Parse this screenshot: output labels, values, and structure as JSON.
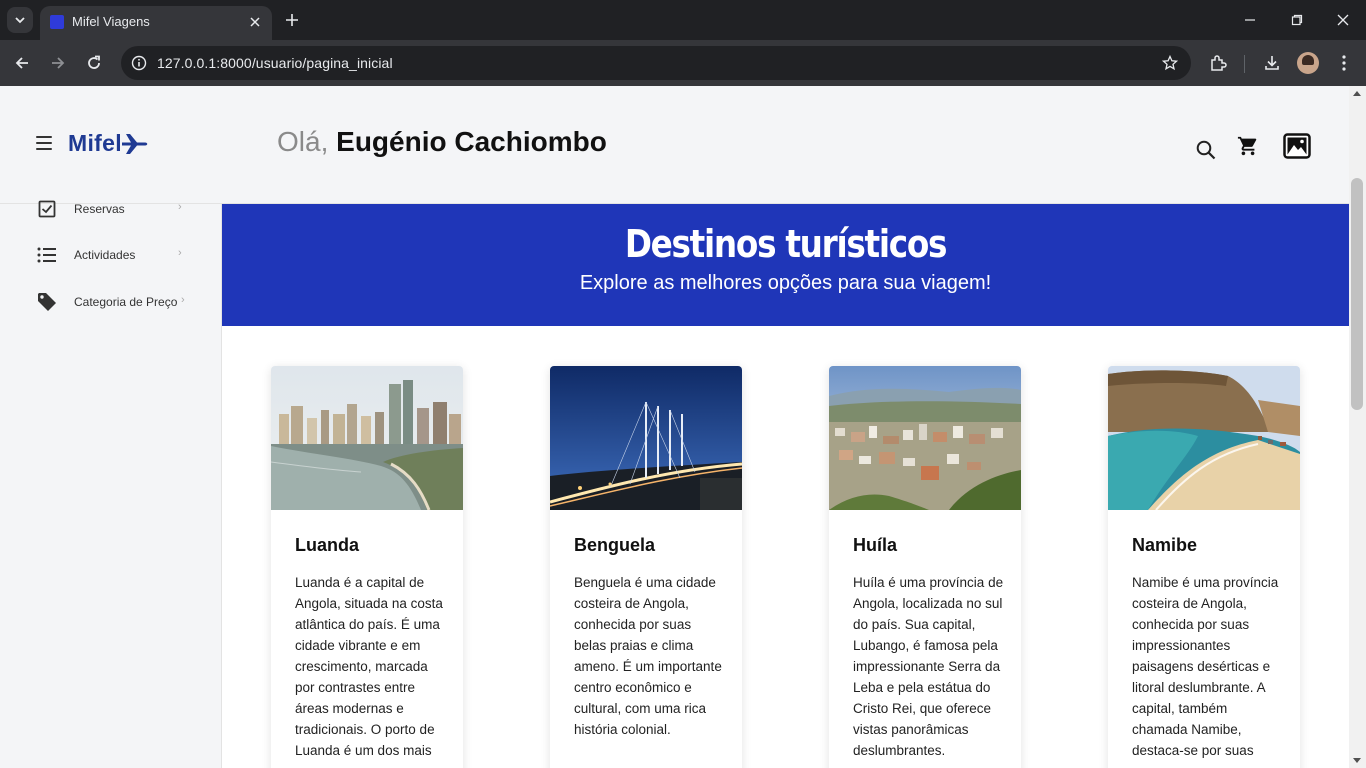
{
  "browser": {
    "tab_title": "Mifel Viagens",
    "url": "127.0.0.1:8000/usuario/pagina_inicial"
  },
  "header": {
    "logo": "Mifel",
    "greeting_prefix": "Olá, ",
    "user_name": "Eugénio Cachiombo"
  },
  "sidebar": {
    "items": [
      {
        "label": "Reservas",
        "icon": "checkbox-icon"
      },
      {
        "label": "Actividades",
        "icon": "list-icon"
      },
      {
        "label": "Categoria de Preço",
        "icon": "tag-icon"
      }
    ]
  },
  "banner": {
    "title": "Destinos turísticos",
    "subtitle": "Explore as melhores opções para sua viagem!"
  },
  "cards": [
    {
      "title": "Luanda",
      "text": "Luanda é a capital de Angola, situada na costa atlântica do país. É uma cidade vibrante e em crescimento, marcada por contrastes entre áreas modernas e tradicionais. O porto de Luanda é um dos mais"
    },
    {
      "title": "Benguela",
      "text": "Benguela é uma cidade costeira de Angola, conhecida por suas belas praias e clima ameno. É um importante centro econômico e cultural, com uma rica história colonial."
    },
    {
      "title": "Huíla",
      "text": "Huíla é uma província de Angola, localizada no sul do país. Sua capital, Lubango, é famosa pela impressionante Serra da Leba e pela estátua do Cristo Rei, que oferece vistas panorâmicas deslumbrantes."
    },
    {
      "title": "Namibe",
      "text": "Namibe é uma província costeira de Angola, conhecida por suas impressionantes paisagens desérticas e litoral deslumbrante. A capital, também chamada Namibe, destaca-se por suas"
    }
  ],
  "colors": {
    "brand_blue": "#1f36b8",
    "logo_blue": "#1f3a93"
  }
}
